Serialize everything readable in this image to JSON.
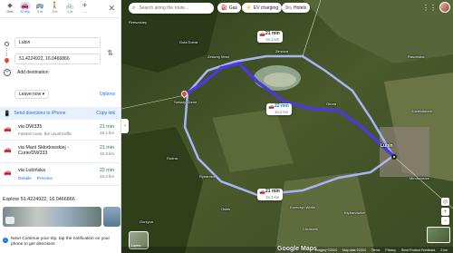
{
  "modes": [
    {
      "label": "Best",
      "icon": "best-route-icon",
      "glyph": "◆",
      "active": false
    },
    {
      "label": "22 min",
      "icon": "car-icon",
      "glyph": "🚗",
      "active": true
    },
    {
      "label": "3 hr",
      "icon": "bus-icon",
      "glyph": "🚌",
      "active": false
    },
    {
      "label": "3 hr",
      "icon": "walk-icon",
      "glyph": "🚶",
      "active": false
    },
    {
      "label": "1 hr",
      "icon": "bike-icon",
      "glyph": "🚲",
      "active": false
    },
    {
      "label": "—",
      "icon": "flight-icon",
      "glyph": "✈",
      "active": false
    }
  ],
  "directions": {
    "origin": "Lubin",
    "destination": "51.4224922, 16.0466866",
    "add_destination": "Add destination",
    "leave_now": "Leave now ▾",
    "options": "Options",
    "send_to_phone": "Send directions to iPhone",
    "copy_link": "Copy link"
  },
  "routes": [
    {
      "name": "via DW335",
      "sub": "Fastest route, the usual traffic",
      "time": "21 min",
      "distance": "18.1 km",
      "links": []
    },
    {
      "name": "via Marii Skłodowskiej - Curie/DW333",
      "sub": "",
      "time": "21 min",
      "distance": "15.3 km",
      "links": []
    },
    {
      "name": "via Lubińska",
      "sub": "",
      "time": "22 min",
      "distance": "15.2 km",
      "links": [
        "Details",
        "Preview"
      ]
    }
  ],
  "explore": {
    "title": "Explore 51.4224922, 16.0466866"
  },
  "notice": {
    "text": "New! Continue your trip, tap the notification on your phone to get directions"
  },
  "map": {
    "search_placeholder": "Search along the route...",
    "chips": [
      "Gas",
      "EV charging",
      "Hotels"
    ],
    "callouts": [
      {
        "time": "21 min",
        "distance": "18.1 km"
      },
      {
        "time": "22 min",
        "distance": "15.2 km"
      },
      {
        "time": "21 min",
        "distance": "15.3 km"
      }
    ],
    "labels": [
      "Rzeszotary",
      "Gola Dolna",
      "Żelazny Most",
      "Zimnica",
      "Rudna",
      "Lubin",
      "Szklary Górne",
      "Obora",
      "Gorzyca",
      "Osiek",
      "Krzeczyn Wielki",
      "Chróstnik",
      "Miroszowice",
      "Raszówka",
      "Rynarcice",
      "Kłębanowice",
      "Zdziesławice"
    ],
    "layers_label": "Layers",
    "footer": [
      "Imagery ©2024",
      "Map data ©2024",
      "Terms",
      "Privacy",
      "Send Product Feedback",
      "2 km"
    ],
    "logo": "Google Maps"
  },
  "colors": {
    "route_selected": "#4b3ad8",
    "route_alt": "#a9b4f5",
    "accent": "#1a73e8"
  }
}
